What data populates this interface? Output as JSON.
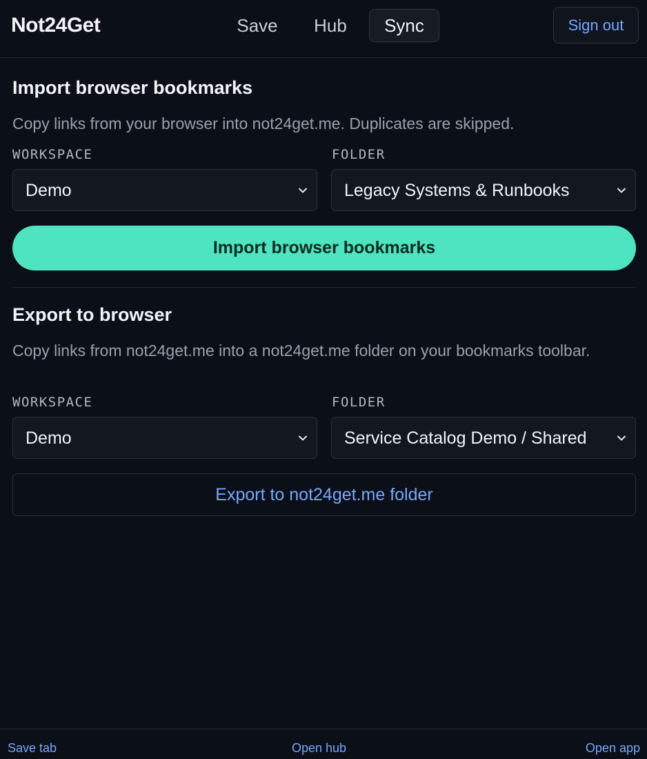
{
  "header": {
    "brand": "Not24Get",
    "tabs": [
      {
        "label": "Save"
      },
      {
        "label": "Hub"
      },
      {
        "label": "Sync"
      }
    ],
    "active_tab": "Sync",
    "sign_out": "Sign out"
  },
  "import_section": {
    "title": "Import browser bookmarks",
    "description": "Copy links from your browser into not24get.me. Duplicates are skipped.",
    "workspace_label": "WORKSPACE",
    "workspace_value": "Demo",
    "folder_label": "FOLDER",
    "folder_value": "Legacy Systems & Runbooks",
    "button": "Import browser bookmarks"
  },
  "export_section": {
    "title": "Export to browser",
    "description": "Copy links from not24get.me into a not24get.me folder on your bookmarks toolbar.",
    "workspace_label": "WORKSPACE",
    "workspace_value": "Demo",
    "folder_label": "FOLDER",
    "folder_value": "Service Catalog Demo / Shared",
    "button": "Export to not24get.me folder"
  },
  "footer": {
    "save_tab": "Save tab",
    "open_hub": "Open hub",
    "open_app": "Open app"
  },
  "colors": {
    "background": "#0b0f17",
    "accent": "#4ee4bf",
    "link": "#7aa7ff"
  }
}
